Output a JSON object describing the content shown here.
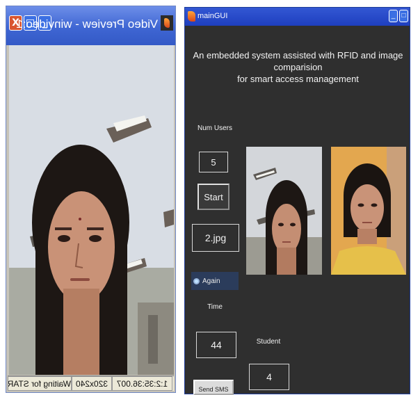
{
  "preview_window": {
    "title": "Video Preview - winvideo:1",
    "controls": {
      "close": "X",
      "maximize": "□",
      "minimize": "_"
    },
    "status_bar": {
      "elapsed": "1:2:35:36.007",
      "resolution": "320x240",
      "message": "Waiting for START"
    }
  },
  "main_window": {
    "title": "mainGUI",
    "heading_line1": "An embedded system assisted with RFID and  image comparision",
    "heading_line2": "for smart access management",
    "num_users_label": "Num Users",
    "num_users_value": "5",
    "start_button": "Start",
    "image_file_field": "2.jpg",
    "again_radio_label": "Again",
    "time_label": "Time",
    "time_value": "44",
    "student_label": "Student",
    "student_value": "4",
    "send_sms_button": "Send SMS"
  },
  "colors": {
    "xp_title_blue": "#3f66d3",
    "gui_background": "#2f2f2f",
    "close_red": "#d9542e"
  }
}
